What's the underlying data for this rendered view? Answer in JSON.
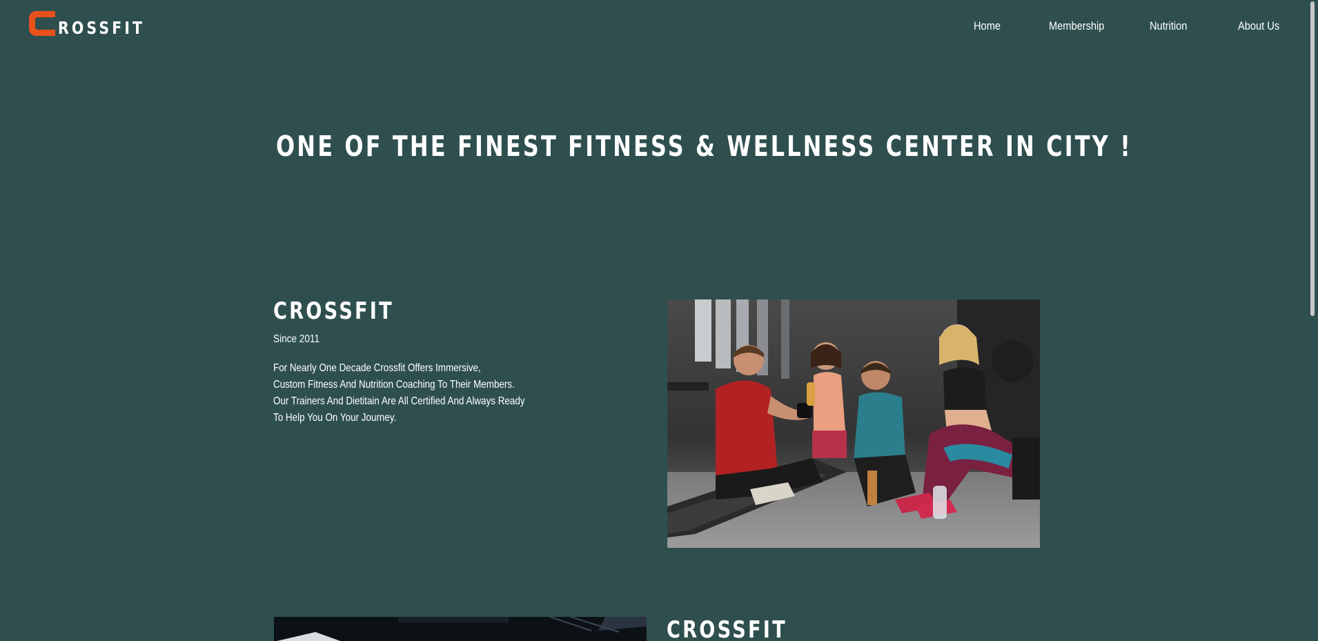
{
  "header": {
    "logo_text": "ROSSFIT",
    "logo_letter": "C",
    "nav": {
      "home": "Home",
      "membership": "Membership",
      "nutrition": "Nutrition",
      "about": "About Us"
    }
  },
  "hero": {
    "title": "ONE OF THE FINEST FITNESS & WELLNESS CENTER IN CITY !"
  },
  "section1": {
    "heading": "CROSSFIT",
    "since": "Since 2011",
    "body_lines": [
      "For Nearly One Decade Crossfit Offers Immersive,",
      "Custom Fitness And Nutrition Coaching To Their Members.",
      "Our Trainers And Dietitain Are All Certified And Always Ready",
      "To Help You On Your Journey."
    ],
    "photo_icon": "group-of-friends-resting-in-gym-photo"
  },
  "section2": {
    "heading": "CROSSFIT",
    "photo_icon": "dark-gym-interior-photo"
  },
  "colors": {
    "background": "#2f4f4f",
    "logo_accent": "#e8501c",
    "text": "#ffffff"
  }
}
